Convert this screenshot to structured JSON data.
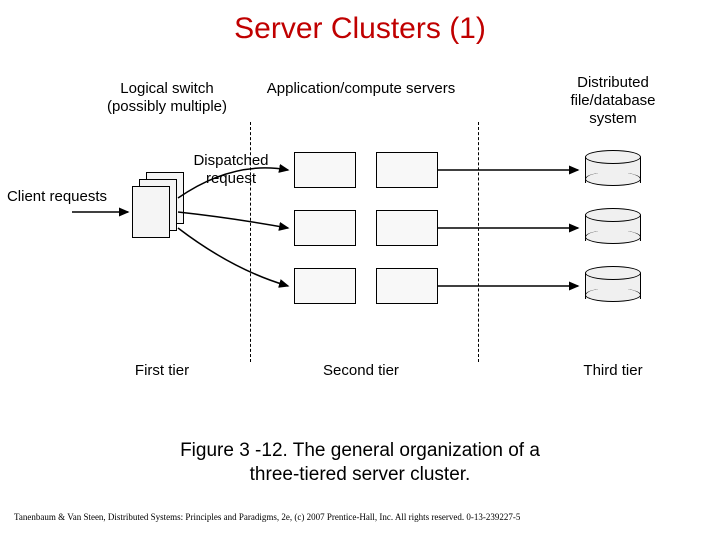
{
  "title": "Server Clusters (1)",
  "labels": {
    "logical_switch": "Logical switch\n(possibly multiple)",
    "app_servers": "Application/compute servers",
    "db_system": "Distributed\nfile/database\nsystem",
    "client_requests": "Client requests",
    "dispatched_request": "Dispatched\nrequest",
    "first_tier": "First tier",
    "second_tier": "Second tier",
    "third_tier": "Third tier"
  },
  "caption": "Figure 3 -12. The general organization of a\nthree-tiered server cluster.",
  "footer": "Tanenbaum & Van Steen, Distributed Systems: Principles and Paradigms, 2e, (c) 2007 Prentice-Hall, Inc. All rights reserved. 0-13-239227-5"
}
